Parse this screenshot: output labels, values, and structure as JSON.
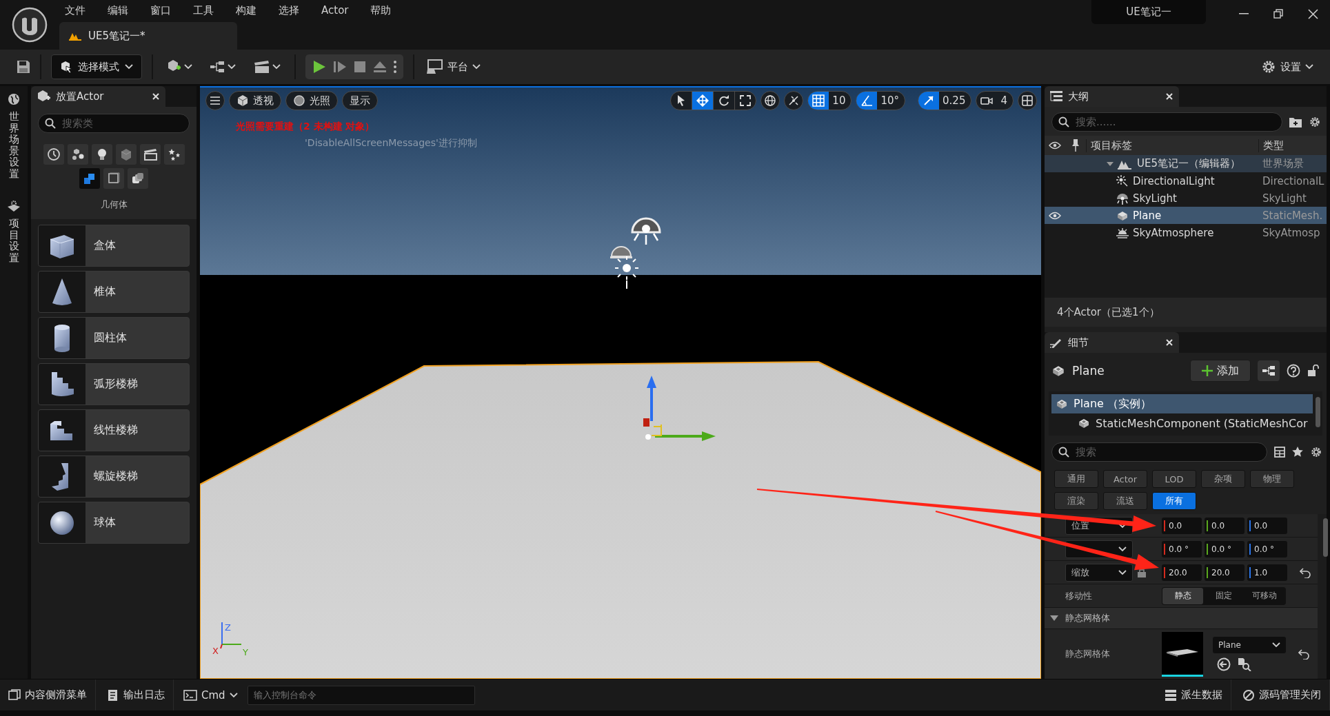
{
  "menu": [
    "文件",
    "编辑",
    "窗口",
    "工具",
    "构建",
    "选择",
    "Actor",
    "帮助"
  ],
  "document_tab": {
    "label": "UE5笔记一*",
    "selected": true
  },
  "project_badge": "UE笔记一",
  "toolbar": {
    "mode": "选择模式",
    "platform": "平台",
    "settings": "设置"
  },
  "side_tabs": [
    "世界场景设置",
    "项目设置"
  ],
  "place_actor": {
    "title": "放置Actor",
    "search": {
      "placeholder": "搜索类"
    },
    "categories": [
      {
        "kind": "recent",
        "selected": false
      },
      {
        "kind": "basic",
        "selected": false
      },
      {
        "kind": "lights",
        "selected": false
      },
      {
        "kind": "shapes",
        "selected": false
      },
      {
        "kind": "cinematic",
        "selected": false
      },
      {
        "kind": "visual",
        "selected": false
      },
      {
        "kind": "geometry",
        "selected": true
      },
      {
        "kind": "volumes",
        "selected": false
      },
      {
        "kind": "all",
        "selected": false
      }
    ],
    "category_label": "几何体",
    "items": [
      {
        "label": "盒体",
        "kind": "box"
      },
      {
        "label": "椎体",
        "kind": "cone"
      },
      {
        "label": "圆柱体",
        "kind": "cylinder"
      },
      {
        "label": "弧形楼梯",
        "kind": "curved_stairs"
      },
      {
        "label": "线性楼梯",
        "kind": "linear_stairs"
      },
      {
        "label": "螺旋楼梯",
        "kind": "spiral_stairs"
      },
      {
        "label": "球体",
        "kind": "sphere"
      }
    ]
  },
  "viewport": {
    "view_buttons": [
      {
        "label": "透视",
        "kind": "perspective"
      },
      {
        "label": "光照",
        "kind": "lit"
      },
      {
        "label": "显示",
        "kind": "show"
      }
    ],
    "tools": [
      {
        "kind": "select",
        "selected": false
      },
      {
        "kind": "translate",
        "selected": true
      },
      {
        "kind": "rotate",
        "selected": false
      },
      {
        "kind": "scale",
        "selected": false
      }
    ],
    "snaps": [
      {
        "kind": "grid",
        "value": "10",
        "on": true
      },
      {
        "kind": "angle",
        "value": "10°",
        "on": true
      },
      {
        "kind": "scale",
        "value": "0.25",
        "on": true
      },
      {
        "kind": "camera",
        "value": "4",
        "on": false
      }
    ],
    "warnings": [
      {
        "text": "光照需要重建（2 未构建 对象）",
        "kind": "error"
      },
      {
        "text": "'DisableAllScreenMessages'进行抑制",
        "kind": "hint"
      }
    ],
    "axis_labels": [
      "Z",
      "X",
      "Y"
    ]
  },
  "outliner": {
    "title": "大纲",
    "search": {
      "placeholder": "搜索......"
    },
    "columns": [
      "项目标签",
      "类型"
    ],
    "rows": [
      {
        "label": "UE5笔记一（编辑器）",
        "type": "世界场景",
        "kind": "world",
        "selected": false,
        "eye": false,
        "expanded": true,
        "children": [
          {
            "label": "DirectionalLight",
            "type": "DirectionalL",
            "kind": "sun",
            "selected": false,
            "eye": false
          },
          {
            "label": "SkyLight",
            "type": "SkyLight",
            "kind": "skylight",
            "selected": false,
            "eye": false
          },
          {
            "label": "Plane",
            "type": "StaticMesh.",
            "kind": "mesh",
            "selected": true,
            "eye": true
          },
          {
            "label": "SkyAtmosphere",
            "type": "SkyAtmosp",
            "kind": "atmosphere",
            "selected": false,
            "eye": false
          }
        ]
      }
    ],
    "status": "4个Actor（已选1个）"
  },
  "details": {
    "title": "细节",
    "actor": "Plane",
    "add_button": "添加",
    "components": [
      {
        "label": "Plane （实例）",
        "selected": true
      },
      {
        "label": "StaticMeshComponent (StaticMeshCor",
        "selected": false
      }
    ],
    "search": {
      "placeholder": "搜索"
    },
    "filters": [
      {
        "label": "通用",
        "selected": false
      },
      {
        "label": "Actor",
        "selected": false
      },
      {
        "label": "LOD",
        "selected": false
      },
      {
        "label": "杂项",
        "selected": false
      },
      {
        "label": "物理",
        "selected": false
      },
      {
        "label": "渲染",
        "selected": false
      },
      {
        "label": "流送",
        "selected": false
      },
      {
        "label": "所有",
        "selected": true
      }
    ],
    "transform": [
      {
        "label": "位置",
        "values": [
          "0.0",
          "0.0",
          "0.0"
        ],
        "locked": false,
        "reset": false
      },
      {
        "values": [
          "0.0 °",
          "0.0 °",
          "0.0 °"
        ],
        "locked": false,
        "reset": false
      },
      {
        "label": "缩放",
        "values": [
          "20.0",
          "20.0",
          "1.0"
        ],
        "locked": true,
        "reset": true
      }
    ],
    "mobility": {
      "label": "移动性",
      "options": [
        {
          "label": "静态",
          "selected": true
        },
        {
          "label": "固定",
          "selected": false
        },
        {
          "label": "可移动",
          "selected": false
        }
      ]
    },
    "section": {
      "title": "静态网格体",
      "expanded": true
    },
    "mesh": {
      "label": "静态网格体",
      "value": "Plane",
      "reset": true
    }
  },
  "bottom_bar": {
    "left": [
      {
        "label": "内容侧滑菜单",
        "kind": "drawer"
      },
      {
        "label": "输出日志",
        "kind": "log"
      }
    ],
    "cmd": "Cmd",
    "console": {
      "placeholder": "输入控制台命令"
    },
    "right": [
      {
        "label": "派生数据",
        "kind": "ddc"
      },
      {
        "label": "源码管理关闭",
        "kind": "scc"
      }
    ]
  },
  "annotations": [
    {
      "kind": "arrow"
    },
    {
      "kind": "arrow"
    }
  ]
}
